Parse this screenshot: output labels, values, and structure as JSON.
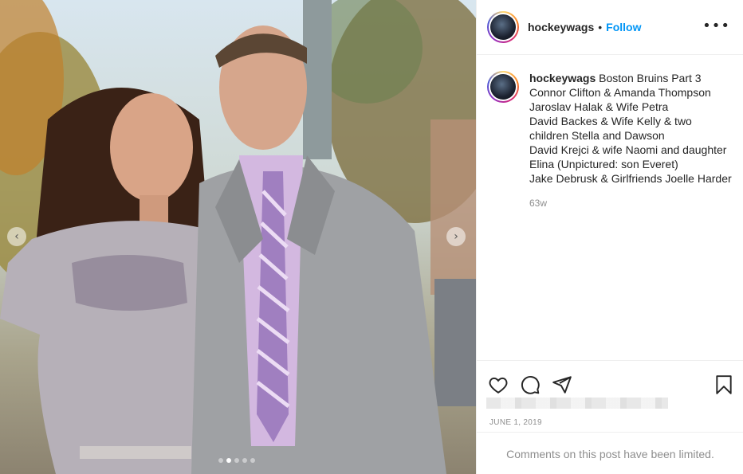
{
  "post": {
    "username": "hockeywags",
    "separator": "•",
    "follow_label": "Follow",
    "more_icon": "more-options-icon",
    "more_glyph": "•••"
  },
  "carousel": {
    "prev_glyph": "‹",
    "next_glyph": "›",
    "dot_count": 5,
    "active_dot": 2
  },
  "caption": {
    "username": "hockeywags",
    "lines": [
      "Boston Bruins Part 3",
      "Connor Clifton & Amanda Thompson",
      "Jaroslav Halak & Wife Petra",
      "David Backes & Wife Kelly & two children Stella and Dawson",
      "David Krejci & wife Naomi and daughter Elina (Unpictured: son Everet)",
      "Jake Debrusk & Girlfriends Joelle Harder"
    ],
    "age": "63w"
  },
  "actions": {
    "like_icon": "heart-icon",
    "comment_icon": "comment-icon",
    "share_icon": "share-icon",
    "save_icon": "bookmark-icon"
  },
  "date": "JUNE 1, 2019",
  "comments_notice": "Comments on this post have been limited."
}
